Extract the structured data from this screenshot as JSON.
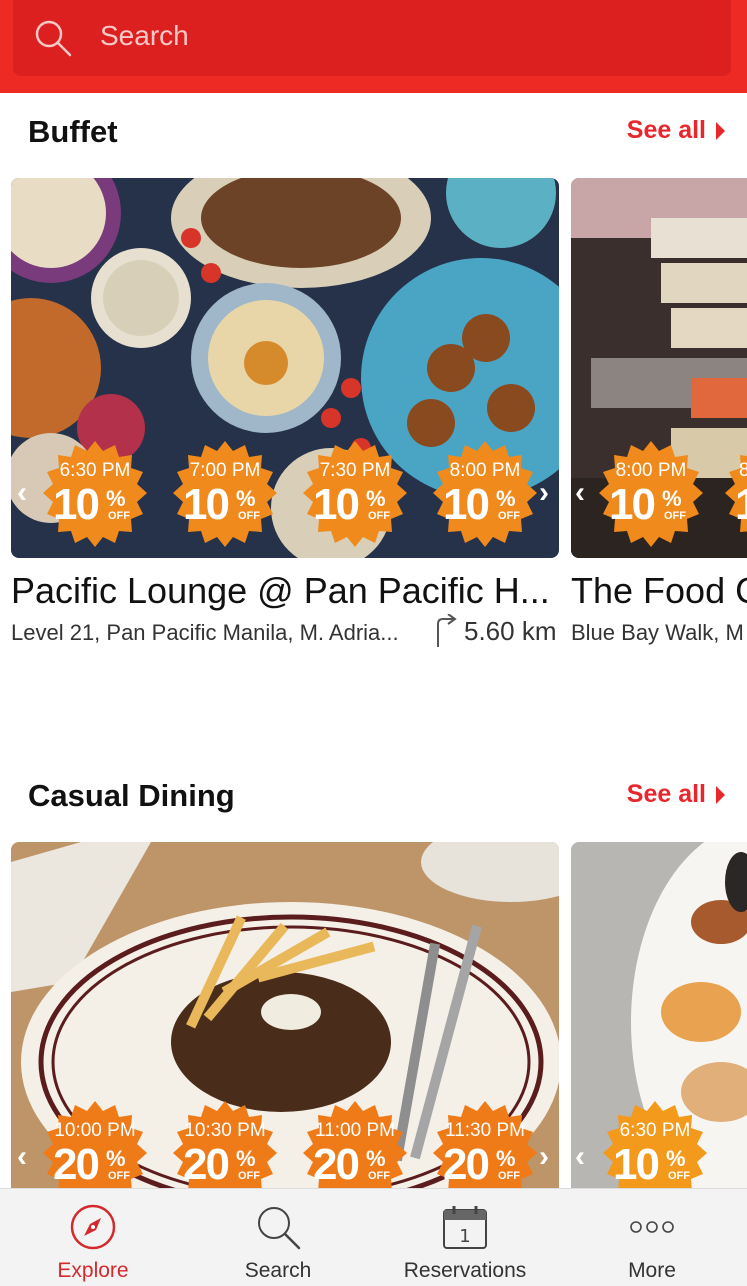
{
  "search": {
    "placeholder": "Search"
  },
  "sections": [
    {
      "title": "Buffet",
      "see_all": "See all",
      "restaurants": [
        {
          "name": "Pacific Lounge @ Pan Pacific H...",
          "address": "Level 21, Pan Pacific Manila, M. Adria...",
          "distance": "5.60 km",
          "deals": [
            {
              "time": "6:30 PM",
              "discount": "10"
            },
            {
              "time": "7:00 PM",
              "discount": "10"
            },
            {
              "time": "7:30 PM",
              "discount": "10"
            },
            {
              "time": "8:00 PM",
              "discount": "10"
            }
          ]
        },
        {
          "name": "The Food C",
          "address": "Blue Bay Walk, M",
          "deals": [
            {
              "time": "8:00 PM",
              "discount": "10"
            },
            {
              "time": "8",
              "discount": "1"
            }
          ]
        }
      ]
    },
    {
      "title": "Casual Dining",
      "see_all": "See all",
      "restaurants": [
        {
          "deals": [
            {
              "time": "10:00 PM",
              "discount": "20"
            },
            {
              "time": "10:30 PM",
              "discount": "20"
            },
            {
              "time": "11:00 PM",
              "discount": "20"
            },
            {
              "time": "11:30 PM",
              "discount": "20"
            }
          ]
        },
        {
          "deals": [
            {
              "time": "6:30 PM",
              "discount": "10"
            }
          ]
        }
      ]
    }
  ],
  "badge": {
    "percent_symbol": "%",
    "off_label": "OFF"
  },
  "nav": [
    {
      "label": "Explore",
      "icon": "compass-icon",
      "active": true
    },
    {
      "label": "Search",
      "icon": "search-icon",
      "active": false
    },
    {
      "label": "Reservations",
      "icon": "calendar-icon",
      "active": false
    },
    {
      "label": "More",
      "icon": "more-dots-icon",
      "active": false
    }
  ],
  "colors": {
    "brand_red": "#ee2a24",
    "badge_orange": "#f08a1c",
    "active_tab": "#d42a2e"
  }
}
